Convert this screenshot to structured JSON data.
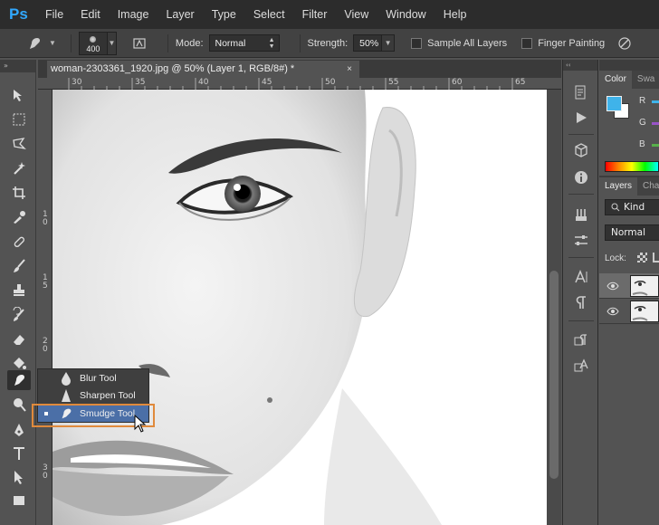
{
  "app": {
    "logo": "Ps"
  },
  "menu": [
    "File",
    "Edit",
    "Image",
    "Layer",
    "Type",
    "Select",
    "Filter",
    "View",
    "Window",
    "Help"
  ],
  "options": {
    "brush_size": "400",
    "mode_label": "Mode:",
    "mode_value": "Normal",
    "strength_label": "Strength:",
    "strength_value": "50%",
    "sample_all_layers": "Sample All Layers",
    "finger_painting": "Finger Painting"
  },
  "document": {
    "tab_title": "woman-2303361_1920.jpg @ 50% (Layer 1, RGB/8#) *",
    "close": "×"
  },
  "ruler": {
    "h_labels": [
      "30",
      "35",
      "40",
      "45",
      "50",
      "55",
      "60",
      "65"
    ],
    "v_labels": [
      "1",
      "1",
      "2",
      "2",
      "3"
    ],
    "v_labels_sub": [
      "0",
      "5",
      "0",
      "5",
      "0"
    ]
  },
  "flyout": {
    "items": [
      {
        "label": "Blur Tool",
        "icon": "blur-drop-icon"
      },
      {
        "label": "Sharpen Tool",
        "icon": "sharpen-triangle-icon"
      },
      {
        "label": "Smudge Tool",
        "icon": "smudge-finger-icon",
        "selected": true
      }
    ]
  },
  "panels": {
    "color_tabs": [
      "Color",
      "Swa"
    ],
    "color_channels": [
      "R",
      "G",
      "B"
    ],
    "channel_colors": [
      "#3fb3ea",
      "#9a54c8",
      "#58b04a"
    ],
    "foreground": "#3fb3ea",
    "background": "#ffffff",
    "layers_tabs": [
      "Layers",
      "Cha"
    ],
    "kind_label": "Kind",
    "blend_mode": "Normal",
    "lock_label": "Lock:"
  },
  "colors": {
    "accent_highlight": "#e08a3c",
    "selection": "#4b6fa7",
    "ps_blue": "#31a8ff"
  }
}
